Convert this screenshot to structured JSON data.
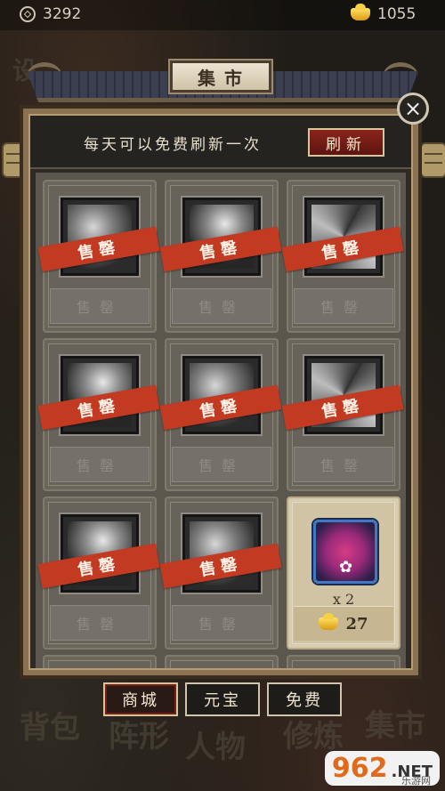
{
  "resources": {
    "coins": "3292",
    "ingots": "1055",
    "coin_icon": "coin-icon",
    "ingot_icon": "gold-ingot-icon"
  },
  "background_words": [
    "设",
    "背包",
    "阵形",
    "人物",
    "修炼",
    "集市"
  ],
  "panel": {
    "title": "集市",
    "close_label": "×",
    "free_refresh_note": "每天可以免费刷新一次",
    "refresh_button": "刷新"
  },
  "cards": [
    {
      "status": "sold",
      "stamp": "售罄",
      "footer": "售罄",
      "icon": "blade-icon"
    },
    {
      "status": "sold",
      "stamp": "售罄",
      "footer": "售罄",
      "icon": "fan-icon"
    },
    {
      "status": "sold",
      "stamp": "售罄",
      "footer": "售罄",
      "icon": "mask-icon"
    },
    {
      "status": "sold",
      "stamp": "售罄",
      "footer": "售罄",
      "icon": "wind-icon"
    },
    {
      "status": "sold",
      "stamp": "售罄",
      "footer": "售罄",
      "icon": "leaf-icon"
    },
    {
      "status": "sold",
      "stamp": "售罄",
      "footer": "售罄",
      "icon": "sword-icon"
    },
    {
      "status": "sold",
      "stamp": "售罄",
      "footer": "售罄",
      "icon": "wave-icon"
    },
    {
      "status": "sold",
      "stamp": "售罄",
      "footer": "售罄",
      "icon": "scroll-icon"
    },
    {
      "status": "available",
      "quantity": "x 2",
      "price": "27",
      "icon": "potion-icon",
      "price_icon": "gold-ingot-icon"
    }
  ],
  "tabs": [
    {
      "label": "商城",
      "active": true
    },
    {
      "label": "元宝",
      "active": false
    },
    {
      "label": "免费",
      "active": false
    }
  ],
  "watermark": {
    "brand": "962",
    "suffix": ".NET",
    "subtitle": "乐游网"
  },
  "colors": {
    "sold_band": "#c23a22",
    "refresh_button": "#8a241c",
    "available_card": "#d8ccb0"
  }
}
